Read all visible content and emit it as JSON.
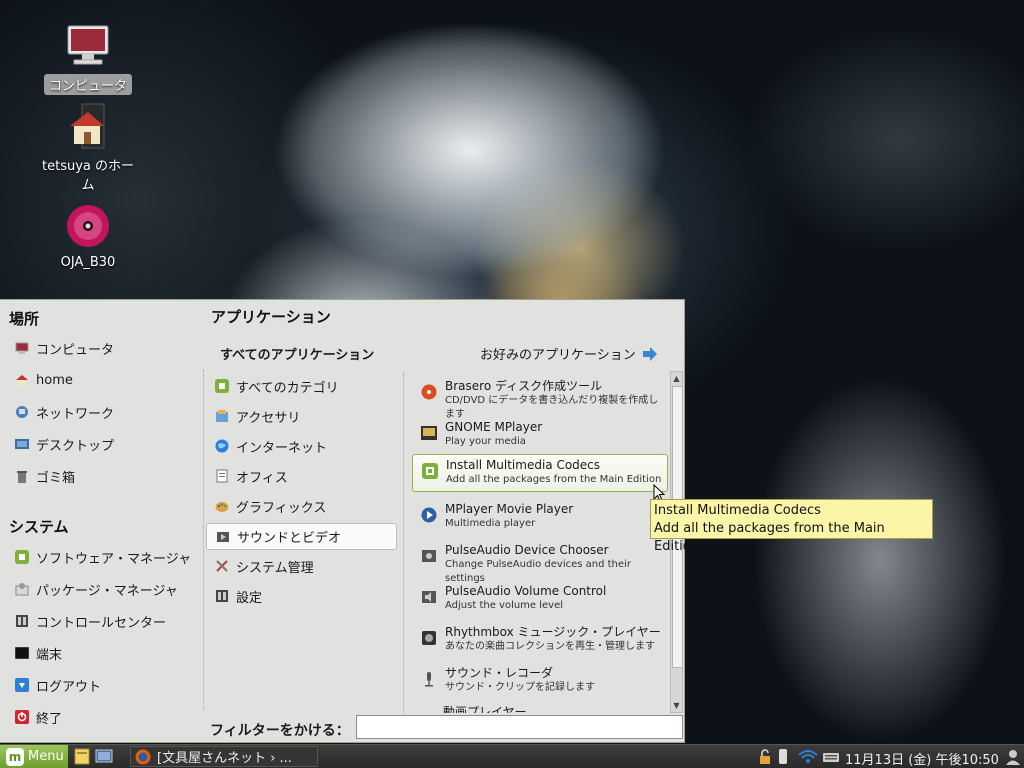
{
  "desktop": {
    "icons": [
      {
        "label": "コンピュータ"
      },
      {
        "label": "tetsuya のホーム"
      },
      {
        "label": "OJA_B30"
      }
    ]
  },
  "menu": {
    "places_title": "場所",
    "places": [
      "コンピュータ",
      "home",
      "ネットワーク",
      "デスクトップ",
      "ゴミ箱"
    ],
    "system_title": "システム",
    "system": [
      "ソフトウェア・マネージャ",
      "パッケージ・マネージャ",
      "コントロールセンター",
      "端末",
      "ログアウト",
      "終了"
    ],
    "apps_title": "アプリケーション",
    "all_apps_label": "すべてのアプリケーション",
    "favorites_label": "お好みのアプリケーション",
    "categories": [
      "すべてのカテゴリ",
      "アクセサリ",
      "インターネット",
      "オフィス",
      "グラフィックス",
      "サウンドとビデオ",
      "システム管理",
      "設定"
    ],
    "active_category": "サウンドとビデオ",
    "apps": [
      {
        "name": "Brasero ディスク作成ツール",
        "desc": "CD/DVD にデータを書き込んだり複製を作成します"
      },
      {
        "name": "GNOME MPlayer",
        "desc": "Play your media"
      },
      {
        "name": "Install Multimedia Codecs",
        "desc": "Add all the packages from the Main Edition"
      },
      {
        "name": "MPlayer Movie Player",
        "desc": "Multimedia player"
      },
      {
        "name": "PulseAudio Device Chooser",
        "desc": "Change PulseAudio devices and their settings"
      },
      {
        "name": "PulseAudio Volume Control",
        "desc": "Adjust the volume level"
      },
      {
        "name": "Rhythmbox ミュージック・プレイヤー",
        "desc": "あなたの楽曲コレクションを再生・管理します"
      },
      {
        "name": "サウンド・レコーダ",
        "desc": "サウンド・クリップを記録します"
      },
      {
        "name": "動画プレイヤー",
        "desc": ""
      }
    ],
    "filter_label": "フィルターをかける：",
    "filter_value": ""
  },
  "tooltip": {
    "line1": "Install Multimedia Codecs",
    "line2": "Add all the packages from the Main Edition"
  },
  "taskbar": {
    "menu_label": "Menu",
    "task_label": "[文具屋さんネット › ...",
    "clock": "11月13日 (金) 午後10:50"
  },
  "colors": {
    "mint_green": "#8fb356",
    "tooltip_bg": "#fbf5a8",
    "menu_bg": "#e1e1e0"
  }
}
